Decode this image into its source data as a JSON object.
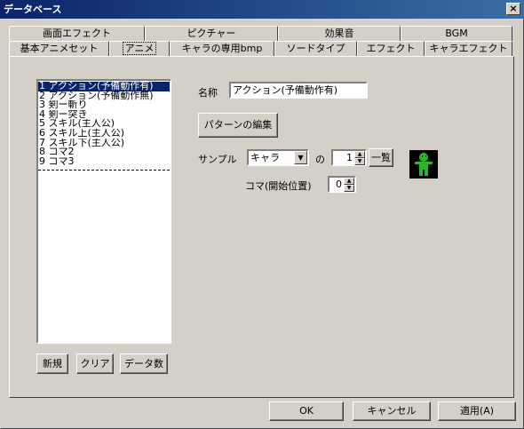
{
  "window": {
    "title": "データベース",
    "close": "×"
  },
  "tabs_back": [
    "画面エフェクト",
    "ピクチャー",
    "効果音",
    "BGM"
  ],
  "tabs_front": [
    "基本アニメセット",
    "アニメ",
    "キャラの専用bmp",
    "ソードタイプ",
    "エフェクト",
    "キャラエフェクト"
  ],
  "active_tab": "アニメ",
  "list": {
    "items": [
      "1 アクション(予備動作有)",
      "2 アクション(予備動作無)",
      "3 剣ー斬り",
      "4 剣ー突き",
      "5 スキル(主人公)",
      "6 スキル上(主人公)",
      "7 スキル下(主人公)",
      "8 コマ2",
      "9 コマ3"
    ],
    "selected_index": 0
  },
  "list_buttons": {
    "new": "新規",
    "clear": "クリア",
    "data_count": "データ数"
  },
  "form": {
    "name_label": "名称",
    "name_value": "アクション(予備動作有)",
    "edit_pattern": "パターンの編集",
    "sample_label": "サンプル",
    "sample_value": "キャラ",
    "no_label": "の",
    "index_value": "1",
    "list_button": "一覧",
    "frame_label": "コマ(開始位置)",
    "frame_value": "0"
  },
  "dialog_buttons": {
    "ok": "OK",
    "cancel": "キャンセル",
    "apply": "適用(A)"
  },
  "colors": {
    "titlebar": "#0a246a",
    "sprite": "#2bb52b",
    "face": "#d4d0c8"
  }
}
